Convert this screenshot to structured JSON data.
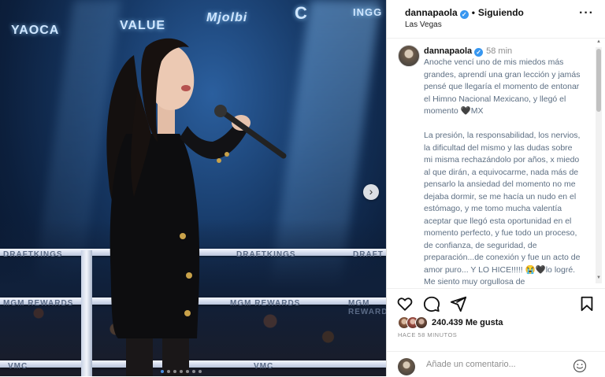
{
  "photo": {
    "sponsors_top": [
      "YAOCA",
      "VALUE",
      "Mjolbi",
      "C",
      "INGG"
    ],
    "rope_texts": [
      "DRAFTKINGS",
      "DRAFTKINGS",
      "DRAFTKINGS",
      "MGM REWARDS",
      "MGM REWARDS",
      "MGM REWARDS",
      "VMC",
      "VMC",
      "DRAFT"
    ],
    "next_icon": "chevron-right-icon"
  },
  "header": {
    "username": "dannapaola",
    "follow_status": "Siguiendo",
    "location": "Las Vegas",
    "more_icon": "more-options-icon"
  },
  "caption": {
    "username": "dannapaola",
    "time": "58 min",
    "text": "Anoche vencí uno de mis miedos más grandes, aprendí una gran lección y jamás pensé que llegaría el momento de entonar el Himno Nacional Mexicano, y llegó el momento 🖤MX\n\nLa presión, la responsabilidad, los nervios, la dificultad del mismo y las dudas sobre mi misma rechazándolo por años, x miedo al que dirán, a equivocarme, nada más de pensarlo la ansiedad del momento no me dejaba dormir, se me hacía un nudo en el estómago, y me tomo mucha valentía aceptar que llegó esta oportunidad en el momento perfecto, y fue todo un proceso, de confianza, de seguridad, de preparación...de conexión y fue un acto de amor puro... Y LO HICE!!!!! 😭🖤lo logré. Me siento muy orgullosa de"
  },
  "actions": {
    "like_icon": "heart-icon",
    "comment_icon": "comment-icon",
    "share_icon": "share-icon",
    "save_icon": "bookmark-icon"
  },
  "likes": {
    "count_text": "240.439 Me gusta",
    "time_ago": "HACE 58 MINUTOS"
  },
  "comment": {
    "placeholder": "Añade un comentario...",
    "emoji_icon": "emoji-icon"
  },
  "colors": {
    "verified_blue": "#3897f0",
    "caption_text": "#5d6f83",
    "muted": "#8e8e8e"
  }
}
